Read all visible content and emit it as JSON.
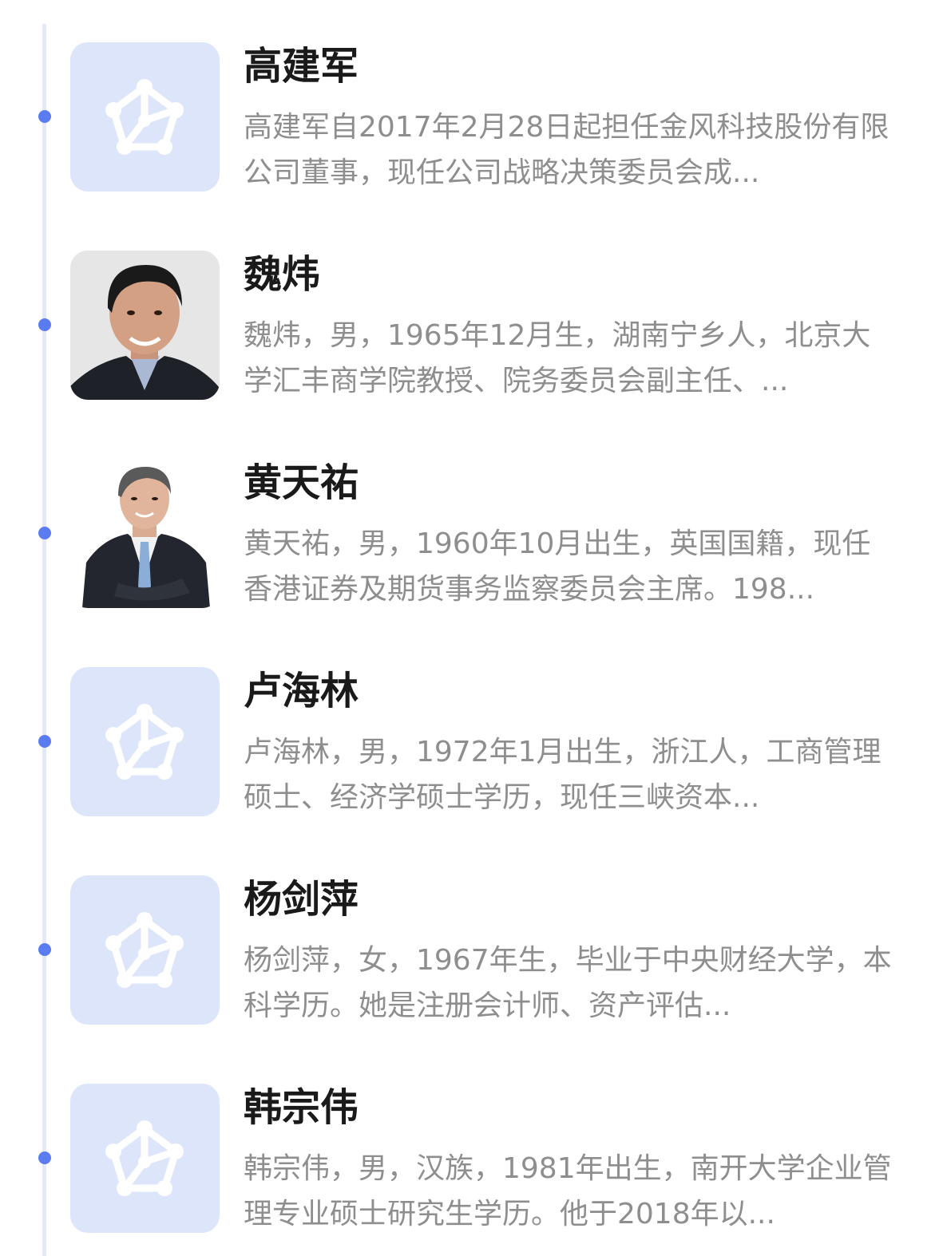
{
  "colors": {
    "timeline_line": "#e3e8fb",
    "timeline_dot": "#5b7cf0",
    "placeholder_bg": "#dde5fa",
    "placeholder_icon": "#ffffff",
    "name_text": "#1a1a1a",
    "bio_text": "#8e8e8e"
  },
  "people": [
    {
      "name": "高建军",
      "bio": "高建军自2017年2月28日起担任金风科技股份有限公司董事，现任公司战略决策委员会成...",
      "avatar": "placeholder-network-icon"
    },
    {
      "name": "魏炜",
      "bio": "魏炜，男，1965年12月生，湖南宁乡人，北京大学汇丰商学院教授、院务委员会副主任、...",
      "avatar": "portrait-photo"
    },
    {
      "name": "黄天祐",
      "bio": "黄天祐，男，1960年10月出生，英国国籍，现任香港证券及期货事务监察委员会主席。198...",
      "avatar": "portrait-photo"
    },
    {
      "name": "卢海林",
      "bio": "卢海林，男，1972年1月出生，浙江人，工商管理硕士、经济学硕士学历，现任三峡资本...",
      "avatar": "placeholder-network-icon"
    },
    {
      "name": "杨剑萍",
      "bio": "杨剑萍，女，1967年生，毕业于中央财经大学，本科学历。她是注册会计师、资产评估...",
      "avatar": "placeholder-network-icon"
    },
    {
      "name": "韩宗伟",
      "bio": "韩宗伟，男，汉族，1981年出生，南开大学企业管理专业硕士研究生学历。他于2018年以...",
      "avatar": "placeholder-network-icon"
    }
  ]
}
